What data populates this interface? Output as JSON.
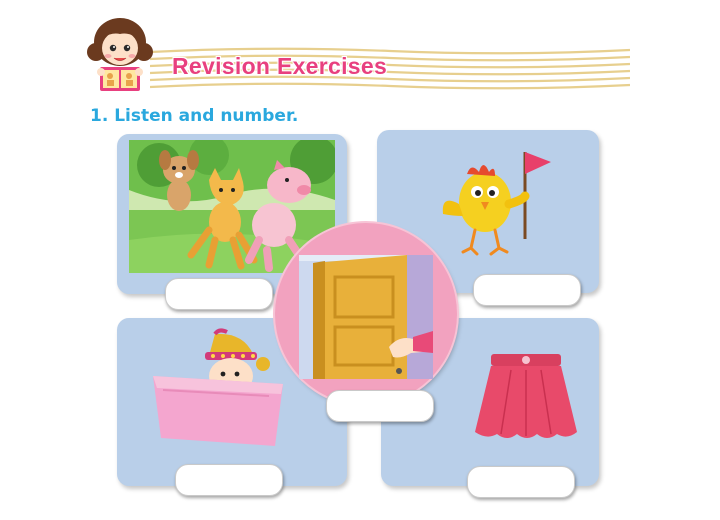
{
  "header": {
    "title": "Revision Exercises"
  },
  "exercise": {
    "instruction": "1. Listen and number."
  },
  "pictures": [
    {
      "subject": "dog, cat and pig running",
      "answer": ""
    },
    {
      "subject": "chick holding a flag",
      "answer": ""
    },
    {
      "subject": "hand opening a door",
      "answer": ""
    },
    {
      "subject": "child in a pink box",
      "answer": ""
    },
    {
      "subject": "pink skirt",
      "answer": ""
    }
  ],
  "colors": {
    "title": "#e8407f",
    "instruction": "#2aa8de",
    "card": "#b9cfe9",
    "circle": "#f2a2bf",
    "stripes": "#e7cf8e"
  }
}
